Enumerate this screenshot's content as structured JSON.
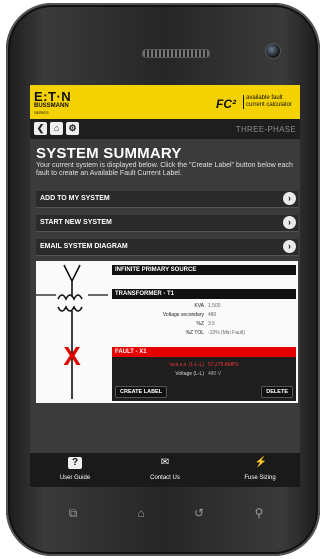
{
  "header": {
    "logo_text": "E:T·N",
    "logo_sub": "BUSSMANN",
    "logo_sub2": "SERIES",
    "fc_logo": "FC²",
    "fc_tagline_1": "available fault",
    "fc_tagline_2": "current calculator",
    "brand_color": "#f4d100"
  },
  "nav": {
    "back_icon": "chevron-left-icon",
    "home_icon": "home-icon",
    "settings_icon": "gear-icon",
    "phase_label": "THREE-PHASE"
  },
  "page": {
    "title": "SYSTEM SUMMARY",
    "description": "Your current system is displayed below. Click the \"Create Label\" button below each fault to create an Available Fault Current Label."
  },
  "menu": [
    {
      "label": "ADD TO MY SYSTEM"
    },
    {
      "label": "START NEW SYSTEM"
    },
    {
      "label": "EMAIL SYSTEM DIAGRAM"
    }
  ],
  "system": {
    "source_label": "INFINITE PRIMARY SOURCE",
    "transformer_label": "TRANSFORMER - T1",
    "transformer_rows": [
      {
        "key": "KVA",
        "value": "1,500"
      },
      {
        "key": "Voltage secondary",
        "value": "480"
      },
      {
        "key": "%Z",
        "value": "3.5"
      },
      {
        "key": "%Z TOL",
        "value": "-10% (Min Fault)"
      }
    ],
    "fault_label": "FAULT - X1",
    "fault_rows": [
      {
        "key": "Isca s.s. (L-L-L)",
        "value": "57,279 AMPS"
      },
      {
        "key": "Voltage (L-L)",
        "value": "480 V"
      }
    ],
    "create_label": "CREATE LABEL",
    "delete_label": "DELETE",
    "fault_color": "#e50000"
  },
  "footer": {
    "items": [
      {
        "label": "User Guide",
        "icon": "question-icon"
      },
      {
        "label": "Contact Us",
        "icon": "mail-icon"
      },
      {
        "label": "Fuse Sizing",
        "icon": "lightning-icon"
      }
    ]
  },
  "softkeys": [
    "recent-apps-icon",
    "home-outline-icon",
    "back-arrow-icon",
    "search-icon"
  ]
}
